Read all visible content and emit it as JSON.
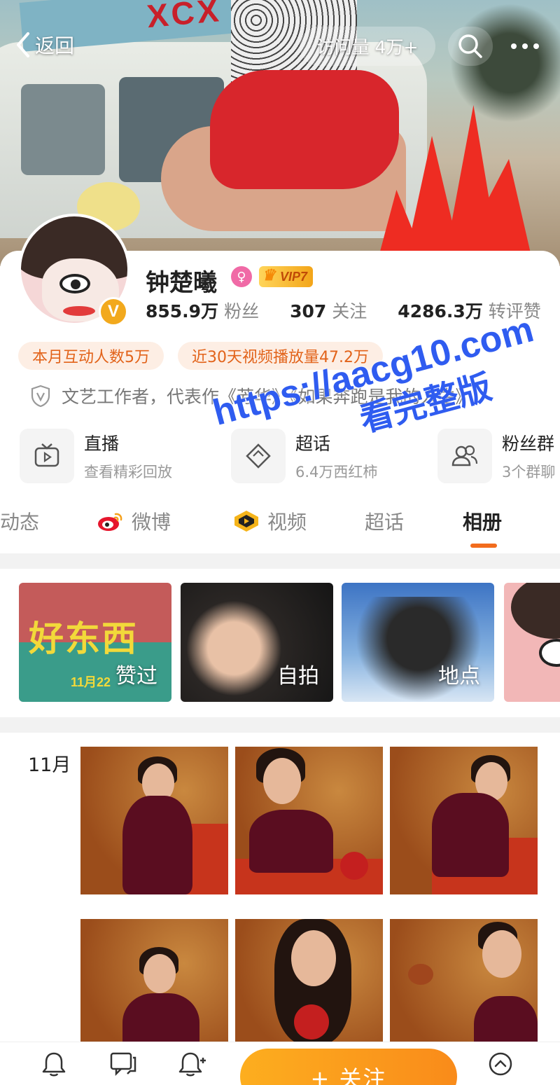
{
  "header": {
    "back_label": "返回",
    "visits_label": "访问量 4万+"
  },
  "cover": {
    "sign_text": "XCX"
  },
  "profile": {
    "name": "钟楚曦",
    "gender_icon": "female-icon",
    "vip_label": "VIP7",
    "verified_badge": "V",
    "stats": [
      {
        "value": "855.9万",
        "label": "粉丝"
      },
      {
        "value": "307",
        "label": "关注"
      },
      {
        "value": "4286.3万",
        "label": "转评赞"
      }
    ],
    "tags": [
      "本月互动人数5万",
      "近30天视频播放量47.2万"
    ],
    "bio": "文艺工作者，代表作《芳华》《如果奔跑是我的人生》"
  },
  "shortcuts": [
    {
      "title": "直播",
      "subtitle": "查看精彩回放",
      "icon": "tv-play-icon"
    },
    {
      "title": "超话",
      "subtitle": "6.4万西红柿",
      "icon": "diamond-icon"
    },
    {
      "title": "粉丝群",
      "subtitle": "3个群聊",
      "icon": "group-icon"
    }
  ],
  "tabs": [
    {
      "label": "动态"
    },
    {
      "label": "微博",
      "icon": "weibo-icon"
    },
    {
      "label": "视频",
      "icon": "video-icon"
    },
    {
      "label": "超话"
    },
    {
      "label": "相册",
      "active": true
    }
  ],
  "albums": [
    {
      "label": "赞过",
      "cover_title": "好东西",
      "cover_date": "11月22"
    },
    {
      "label": "自拍"
    },
    {
      "label": "地点"
    },
    {
      "label": ""
    }
  ],
  "photos": {
    "month": "11月"
  },
  "watermark": {
    "line1": "https://aacg10.com",
    "line2": "看完整版"
  },
  "bottom": {
    "follow_label": "+ 关注"
  },
  "colors": {
    "accent": "#f26c1d",
    "tag_bg": "#fdeee4",
    "follow_button": "#fba21d",
    "watermark": "#2f5cf0"
  }
}
